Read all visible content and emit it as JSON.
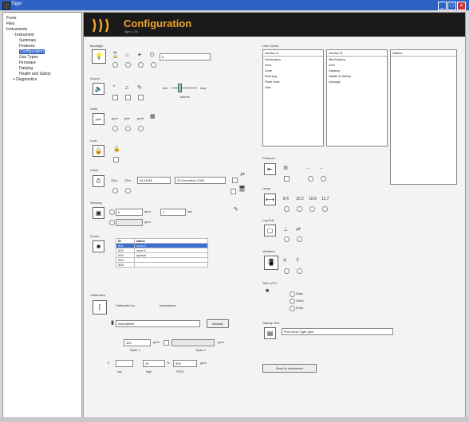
{
  "window": {
    "title": "Tiger"
  },
  "sidebar": {
    "items": [
      {
        "label": "Fonts",
        "indent": 0
      },
      {
        "label": "Files",
        "indent": 0
      },
      {
        "label": "Instruments",
        "indent": 0
      },
      {
        "label": "- Instrument",
        "indent": 1
      },
      {
        "label": "Summary",
        "indent": 2
      },
      {
        "label": "Features",
        "indent": 2
      },
      {
        "label": "Configuration",
        "indent": 2,
        "selected": true
      },
      {
        "label": "Gas Types",
        "indent": 2
      },
      {
        "label": "Firmware",
        "indent": 2
      },
      {
        "label": "Datalog",
        "indent": 2
      },
      {
        "label": "Health and Safety",
        "indent": 2
      },
      {
        "label": "+ Diagnostics",
        "indent": 1
      }
    ]
  },
  "banner": {
    "title": "Configuration",
    "subtitle": "tiger 1.0b"
  },
  "sections": {
    "backlight": "Backlight",
    "sound": "Sound",
    "units": "Units",
    "lock": "Lock",
    "clock": "Clock",
    "sensing": "Sensing",
    "zones": "Zones",
    "calibration": "Calibration",
    "userview": "User Views",
    "pressure": "Pressure",
    "lamp": "Lamp",
    "logfull": "Log Full",
    "vibration": "Vibration",
    "tba": "Tiber (CF)",
    "startup": "Startup Text"
  },
  "backlight": {
    "value": "5"
  },
  "sound": {
    "min": "min",
    "max": "max",
    "volume": "volume"
  },
  "units": {
    "u1": "ppm",
    "u2": "ppb",
    "u3": "pprb"
  },
  "clock": {
    "h24": "24hr",
    "h12": "12hr",
    "time": "16:15:56",
    "date": "23 December 2005"
  },
  "sensing": {
    "value1": "0",
    "unit1": "ppm",
    "value2": "2",
    "unit2": "sec",
    "unit3": "ppm"
  },
  "zones": {
    "headers": [
      "ID",
      "Name"
    ],
    "rows": [
      {
        "id": "001",
        "name": "zone 1",
        "selected": true
      },
      {
        "id": "002",
        "name": "zone 2"
      },
      {
        "id": "003",
        "name": "sphere"
      },
      {
        "id": "004",
        "name": ""
      },
      {
        "id": "005",
        "name": ""
      }
    ]
  },
  "calibration": {
    "calibrated_for": "Calibrated for ...",
    "isobutylene": "Isobutylene",
    "gas": "Isobutylene",
    "browse": "Browse",
    "span1_val": "100",
    "span1_unit": "ppm",
    "span1_label": "Span 1",
    "span2_unit": "ppm",
    "span2_label": "Span 2",
    "alarm_low": "0",
    "alarm_hi": "25",
    "pct": "%",
    "alarm_max": "900",
    "ppm_label": "ppm",
    "low_label": "low",
    "high_label": "high",
    "stel_label": "STEL"
  },
  "userview": {
    "col1_header": "Section A",
    "col2_header": "Section B",
    "col3_header": "Neither",
    "col1": [
      "Information",
      "Zero",
      "Zone",
      "Running",
      "Peak Hold",
      "Gas"
    ],
    "col2": [
      "Min/Options",
      "Zero",
      "Datalog",
      "Health & Safety",
      "Average"
    ]
  },
  "lamp": {
    "v1": "8.4",
    "v2": "10.2",
    "v3": "10.6",
    "v4": "11.7"
  },
  "tba": {
    "opt1": "Data",
    "opt2": "Odds",
    "opt3": "Ends"
  },
  "startup": {
    "text": "PhoCheck Tiger ppm"
  },
  "send_button": "Send to Instrument"
}
